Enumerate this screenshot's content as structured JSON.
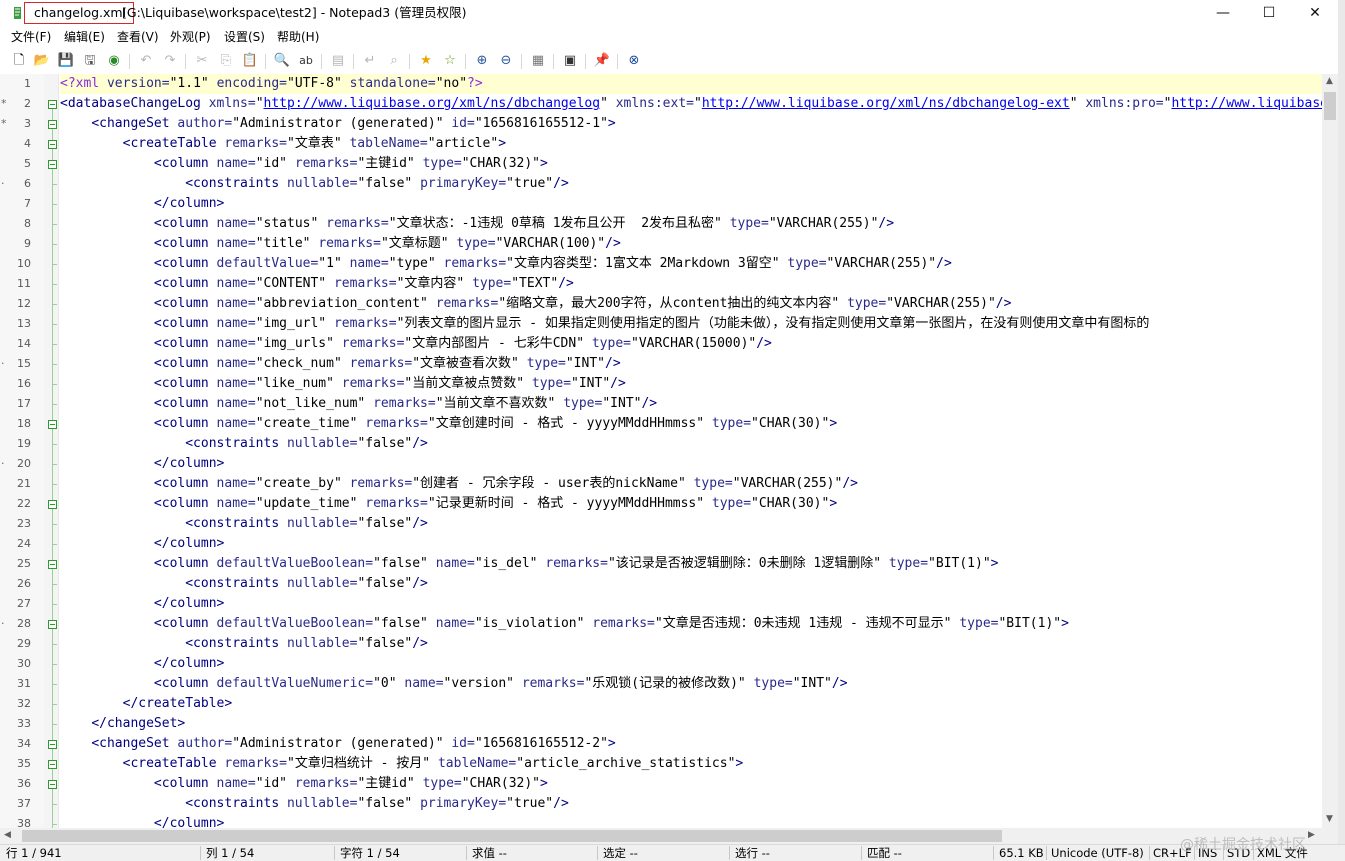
{
  "window": {
    "file_name": "changelog.xml",
    "title_rest": "[G:\\Liquibase\\workspace\\test2] - Notepad3  (管理员权限)",
    "minimize_glyph": "—",
    "maximize_glyph": "☐",
    "close_glyph": "✕"
  },
  "menu": [
    {
      "label": "文件(F)"
    },
    {
      "label": "编辑(E)"
    },
    {
      "label": "查看(V)"
    },
    {
      "label": "外观(P)"
    },
    {
      "label": "设置(S)"
    },
    {
      "label": "帮助(H)"
    }
  ],
  "toolbar": [
    {
      "name": "new-file-icon",
      "glyph": "🗋"
    },
    {
      "name": "open-folder-icon",
      "glyph": "📂"
    },
    {
      "name": "save-icon",
      "glyph": "💾"
    },
    {
      "name": "save-as-icon",
      "glyph": "🖫"
    },
    {
      "name": "browse-icon",
      "glyph": "◉"
    },
    {
      "name": "undo-icon",
      "glyph": "↶"
    },
    {
      "name": "redo-icon",
      "glyph": "↷"
    },
    {
      "name": "cut-icon",
      "glyph": "✂"
    },
    {
      "name": "copy-icon",
      "glyph": "⎘"
    },
    {
      "name": "paste-icon",
      "glyph": "📋"
    },
    {
      "name": "find-icon",
      "glyph": "🔍"
    },
    {
      "name": "replace-icon",
      "glyph": "ab"
    },
    {
      "name": "goto-icon",
      "glyph": "▤"
    },
    {
      "name": "wordwrap-icon",
      "glyph": "↵"
    },
    {
      "name": "find-next-icon",
      "glyph": "⌕"
    },
    {
      "name": "favorite-icon",
      "glyph": "★"
    },
    {
      "name": "add-favorite-icon",
      "glyph": "☆"
    },
    {
      "name": "zoom-in-icon",
      "glyph": "⊕"
    },
    {
      "name": "zoom-out-icon",
      "glyph": "⊖"
    },
    {
      "name": "scheme-icon",
      "glyph": "▦"
    },
    {
      "name": "console-icon",
      "glyph": "▣"
    },
    {
      "name": "pin-icon",
      "glyph": "📌"
    },
    {
      "name": "close-doc-icon",
      "glyph": "⊗"
    }
  ],
  "code_lines": [
    [
      [
        "pi",
        "<?xml "
      ],
      [
        "piattr",
        "version="
      ],
      [
        "val",
        "\"1.1\" "
      ],
      [
        "piattr",
        "encoding="
      ],
      [
        "val",
        "\"UTF-8\" "
      ],
      [
        "piattr",
        "standalone="
      ],
      [
        "val",
        "\"no\""
      ],
      [
        "pi",
        "?>"
      ]
    ],
    [
      [
        "tag",
        "<databaseChangeLog "
      ],
      [
        "attr",
        "xmlns="
      ],
      [
        "val",
        "\""
      ],
      [
        "url",
        "http://www.liquibase.org/xml/ns/dbchangelog"
      ],
      [
        "val",
        "\" "
      ],
      [
        "attr",
        "xmlns:ext="
      ],
      [
        "val",
        "\""
      ],
      [
        "url",
        "http://www.liquibase.org/xml/ns/dbchangelog-ext"
      ],
      [
        "val",
        "\" "
      ],
      [
        "attr",
        "xmlns:pro="
      ],
      [
        "val",
        "\""
      ],
      [
        "url",
        "http://www.liquibase.org/xml/ns/pro"
      ]
    ],
    [
      [
        "val",
        "    "
      ],
      [
        "tag",
        "<changeSet "
      ],
      [
        "attr",
        "author="
      ],
      [
        "val",
        "\"Administrator (generated)\" "
      ],
      [
        "attr",
        "id="
      ],
      [
        "val",
        "\"1656816165512-1\""
      ],
      [
        "tag",
        ">"
      ]
    ],
    [
      [
        "val",
        "        "
      ],
      [
        "tag",
        "<createTable "
      ],
      [
        "attr",
        "remarks="
      ],
      [
        "val",
        "\"文章表\" "
      ],
      [
        "attr",
        "tableName="
      ],
      [
        "val",
        "\"article\""
      ],
      [
        "tag",
        ">"
      ]
    ],
    [
      [
        "val",
        "            "
      ],
      [
        "tag",
        "<column "
      ],
      [
        "attr",
        "name="
      ],
      [
        "val",
        "\"id\" "
      ],
      [
        "attr",
        "remarks="
      ],
      [
        "val",
        "\"主键id\" "
      ],
      [
        "attr",
        "type="
      ],
      [
        "val",
        "\"CHAR(32)\""
      ],
      [
        "tag",
        ">"
      ]
    ],
    [
      [
        "val",
        "                "
      ],
      [
        "tag",
        "<constraints "
      ],
      [
        "attr",
        "nullable="
      ],
      [
        "val",
        "\"false\" "
      ],
      [
        "attr",
        "primaryKey="
      ],
      [
        "val",
        "\"true\""
      ],
      [
        "tag",
        "/>"
      ]
    ],
    [
      [
        "val",
        "            "
      ],
      [
        "tag",
        "</column>"
      ]
    ],
    [
      [
        "val",
        "            "
      ],
      [
        "tag",
        "<column "
      ],
      [
        "attr",
        "name="
      ],
      [
        "val",
        "\"status\" "
      ],
      [
        "attr",
        "remarks="
      ],
      [
        "val",
        "\"文章状态：-1违规 0草稿 1发布且公开  2发布且私密\" "
      ],
      [
        "attr",
        "type="
      ],
      [
        "val",
        "\"VARCHAR(255)\""
      ],
      [
        "tag",
        "/>"
      ]
    ],
    [
      [
        "val",
        "            "
      ],
      [
        "tag",
        "<column "
      ],
      [
        "attr",
        "name="
      ],
      [
        "val",
        "\"title\" "
      ],
      [
        "attr",
        "remarks="
      ],
      [
        "val",
        "\"文章标题\" "
      ],
      [
        "attr",
        "type="
      ],
      [
        "val",
        "\"VARCHAR(100)\""
      ],
      [
        "tag",
        "/>"
      ]
    ],
    [
      [
        "val",
        "            "
      ],
      [
        "tag",
        "<column "
      ],
      [
        "attr",
        "defaultValue="
      ],
      [
        "val",
        "\"1\" "
      ],
      [
        "attr",
        "name="
      ],
      [
        "val",
        "\"type\" "
      ],
      [
        "attr",
        "remarks="
      ],
      [
        "val",
        "\"文章内容类型：1富文本 2Markdown 3留空\" "
      ],
      [
        "attr",
        "type="
      ],
      [
        "val",
        "\"VARCHAR(255)\""
      ],
      [
        "tag",
        "/>"
      ]
    ],
    [
      [
        "val",
        "            "
      ],
      [
        "tag",
        "<column "
      ],
      [
        "attr",
        "name="
      ],
      [
        "val",
        "\"CONTENT\" "
      ],
      [
        "attr",
        "remarks="
      ],
      [
        "val",
        "\"文章内容\" "
      ],
      [
        "attr",
        "type="
      ],
      [
        "val",
        "\"TEXT\""
      ],
      [
        "tag",
        "/>"
      ]
    ],
    [
      [
        "val",
        "            "
      ],
      [
        "tag",
        "<column "
      ],
      [
        "attr",
        "name="
      ],
      [
        "val",
        "\"abbreviation_content\" "
      ],
      [
        "attr",
        "remarks="
      ],
      [
        "val",
        "\"缩略文章，最大200字符，从content抽出的纯文本内容\" "
      ],
      [
        "attr",
        "type="
      ],
      [
        "val",
        "\"VARCHAR(255)\""
      ],
      [
        "tag",
        "/>"
      ]
    ],
    [
      [
        "val",
        "            "
      ],
      [
        "tag",
        "<column "
      ],
      [
        "attr",
        "name="
      ],
      [
        "val",
        "\"img_url\" "
      ],
      [
        "attr",
        "remarks="
      ],
      [
        "val",
        "\"列表文章的图片显示 - 如果指定则使用指定的图片（功能未做），没有指定则使用文章第一张图片，在没有则使用文章中有图标的"
      ]
    ],
    [
      [
        "val",
        "            "
      ],
      [
        "tag",
        "<column "
      ],
      [
        "attr",
        "name="
      ],
      [
        "val",
        "\"img_urls\" "
      ],
      [
        "attr",
        "remarks="
      ],
      [
        "val",
        "\"文章内部图片 - 七彩牛CDN\" "
      ],
      [
        "attr",
        "type="
      ],
      [
        "val",
        "\"VARCHAR(15000)\""
      ],
      [
        "tag",
        "/>"
      ]
    ],
    [
      [
        "val",
        "            "
      ],
      [
        "tag",
        "<column "
      ],
      [
        "attr",
        "name="
      ],
      [
        "val",
        "\"check_num\" "
      ],
      [
        "attr",
        "remarks="
      ],
      [
        "val",
        "\"文章被查看次数\" "
      ],
      [
        "attr",
        "type="
      ],
      [
        "val",
        "\"INT\""
      ],
      [
        "tag",
        "/>"
      ]
    ],
    [
      [
        "val",
        "            "
      ],
      [
        "tag",
        "<column "
      ],
      [
        "attr",
        "name="
      ],
      [
        "val",
        "\"like_num\" "
      ],
      [
        "attr",
        "remarks="
      ],
      [
        "val",
        "\"当前文章被点赞数\" "
      ],
      [
        "attr",
        "type="
      ],
      [
        "val",
        "\"INT\""
      ],
      [
        "tag",
        "/>"
      ]
    ],
    [
      [
        "val",
        "            "
      ],
      [
        "tag",
        "<column "
      ],
      [
        "attr",
        "name="
      ],
      [
        "val",
        "\"not_like_num\" "
      ],
      [
        "attr",
        "remarks="
      ],
      [
        "val",
        "\"当前文章不喜欢数\" "
      ],
      [
        "attr",
        "type="
      ],
      [
        "val",
        "\"INT\""
      ],
      [
        "tag",
        "/>"
      ]
    ],
    [
      [
        "val",
        "            "
      ],
      [
        "tag",
        "<column "
      ],
      [
        "attr",
        "name="
      ],
      [
        "val",
        "\"create_time\" "
      ],
      [
        "attr",
        "remarks="
      ],
      [
        "val",
        "\"文章创建时间 - 格式 - yyyyMMddHHmmss\" "
      ],
      [
        "attr",
        "type="
      ],
      [
        "val",
        "\"CHAR(30)\""
      ],
      [
        "tag",
        ">"
      ]
    ],
    [
      [
        "val",
        "                "
      ],
      [
        "tag",
        "<constraints "
      ],
      [
        "attr",
        "nullable="
      ],
      [
        "val",
        "\"false\""
      ],
      [
        "tag",
        "/>"
      ]
    ],
    [
      [
        "val",
        "            "
      ],
      [
        "tag",
        "</column>"
      ]
    ],
    [
      [
        "val",
        "            "
      ],
      [
        "tag",
        "<column "
      ],
      [
        "attr",
        "name="
      ],
      [
        "val",
        "\"create_by\" "
      ],
      [
        "attr",
        "remarks="
      ],
      [
        "val",
        "\"创建者 - 冗余字段 - user表的nickName\" "
      ],
      [
        "attr",
        "type="
      ],
      [
        "val",
        "\"VARCHAR(255)\""
      ],
      [
        "tag",
        "/>"
      ]
    ],
    [
      [
        "val",
        "            "
      ],
      [
        "tag",
        "<column "
      ],
      [
        "attr",
        "name="
      ],
      [
        "val",
        "\"update_time\" "
      ],
      [
        "attr",
        "remarks="
      ],
      [
        "val",
        "\"记录更新时间 - 格式 - yyyyMMddHHmmss\" "
      ],
      [
        "attr",
        "type="
      ],
      [
        "val",
        "\"CHAR(30)\""
      ],
      [
        "tag",
        ">"
      ]
    ],
    [
      [
        "val",
        "                "
      ],
      [
        "tag",
        "<constraints "
      ],
      [
        "attr",
        "nullable="
      ],
      [
        "val",
        "\"false\""
      ],
      [
        "tag",
        "/>"
      ]
    ],
    [
      [
        "val",
        "            "
      ],
      [
        "tag",
        "</column>"
      ]
    ],
    [
      [
        "val",
        "            "
      ],
      [
        "tag",
        "<column "
      ],
      [
        "attr",
        "defaultValueBoolean="
      ],
      [
        "val",
        "\"false\" "
      ],
      [
        "attr",
        "name="
      ],
      [
        "val",
        "\"is_del\" "
      ],
      [
        "attr",
        "remarks="
      ],
      [
        "val",
        "\"该记录是否被逻辑删除：0未删除 1逻辑删除\" "
      ],
      [
        "attr",
        "type="
      ],
      [
        "val",
        "\"BIT(1)\""
      ],
      [
        "tag",
        ">"
      ]
    ],
    [
      [
        "val",
        "                "
      ],
      [
        "tag",
        "<constraints "
      ],
      [
        "attr",
        "nullable="
      ],
      [
        "val",
        "\"false\""
      ],
      [
        "tag",
        "/>"
      ]
    ],
    [
      [
        "val",
        "            "
      ],
      [
        "tag",
        "</column>"
      ]
    ],
    [
      [
        "val",
        "            "
      ],
      [
        "tag",
        "<column "
      ],
      [
        "attr",
        "defaultValueBoolean="
      ],
      [
        "val",
        "\"false\" "
      ],
      [
        "attr",
        "name="
      ],
      [
        "val",
        "\"is_violation\" "
      ],
      [
        "attr",
        "remarks="
      ],
      [
        "val",
        "\"文章是否违规：0未违规 1违规 - 违规不可显示\" "
      ],
      [
        "attr",
        "type="
      ],
      [
        "val",
        "\"BIT(1)\""
      ],
      [
        "tag",
        ">"
      ]
    ],
    [
      [
        "val",
        "                "
      ],
      [
        "tag",
        "<constraints "
      ],
      [
        "attr",
        "nullable="
      ],
      [
        "val",
        "\"false\""
      ],
      [
        "tag",
        "/>"
      ]
    ],
    [
      [
        "val",
        "            "
      ],
      [
        "tag",
        "</column>"
      ]
    ],
    [
      [
        "val",
        "            "
      ],
      [
        "tag",
        "<column "
      ],
      [
        "attr",
        "defaultValueNumeric="
      ],
      [
        "val",
        "\"0\" "
      ],
      [
        "attr",
        "name="
      ],
      [
        "val",
        "\"version\" "
      ],
      [
        "attr",
        "remarks="
      ],
      [
        "val",
        "\"乐观锁(记录的被修改数)\" "
      ],
      [
        "attr",
        "type="
      ],
      [
        "val",
        "\"INT\""
      ],
      [
        "tag",
        "/>"
      ]
    ],
    [
      [
        "val",
        "        "
      ],
      [
        "tag",
        "</createTable>"
      ]
    ],
    [
      [
        "val",
        "    "
      ],
      [
        "tag",
        "</changeSet>"
      ]
    ],
    [
      [
        "val",
        "    "
      ],
      [
        "tag",
        "<changeSet "
      ],
      [
        "attr",
        "author="
      ],
      [
        "val",
        "\"Administrator (generated)\" "
      ],
      [
        "attr",
        "id="
      ],
      [
        "val",
        "\"1656816165512-2\""
      ],
      [
        "tag",
        ">"
      ]
    ],
    [
      [
        "val",
        "        "
      ],
      [
        "tag",
        "<createTable "
      ],
      [
        "attr",
        "remarks="
      ],
      [
        "val",
        "\"文章归档统计 - 按月\" "
      ],
      [
        "attr",
        "tableName="
      ],
      [
        "val",
        "\"article_archive_statistics\""
      ],
      [
        "tag",
        ">"
      ]
    ],
    [
      [
        "val",
        "            "
      ],
      [
        "tag",
        "<column "
      ],
      [
        "attr",
        "name="
      ],
      [
        "val",
        "\"id\" "
      ],
      [
        "attr",
        "remarks="
      ],
      [
        "val",
        "\"主键id\" "
      ],
      [
        "attr",
        "type="
      ],
      [
        "val",
        "\"CHAR(32)\""
      ],
      [
        "tag",
        ">"
      ]
    ],
    [
      [
        "val",
        "                "
      ],
      [
        "tag",
        "<constraints "
      ],
      [
        "attr",
        "nullable="
      ],
      [
        "val",
        "\"false\" "
      ],
      [
        "attr",
        "primaryKey="
      ],
      [
        "val",
        "\"true\""
      ],
      [
        "tag",
        "/>"
      ]
    ],
    [
      [
        "val",
        "            "
      ],
      [
        "tag",
        "</column>"
      ]
    ]
  ],
  "fold_lines": [
    2,
    3,
    4,
    5,
    18,
    22,
    25,
    28,
    34,
    35,
    36
  ],
  "gutter_marks": {
    "2": "*",
    "3": "*",
    "6": "·",
    "15": "·",
    "20": "·",
    "28": "·"
  },
  "status": {
    "line": "行  1 / 941",
    "col": "列  1 / 54",
    "char": "字符  1 / 54",
    "value": "求值  --",
    "selected": "选定  --",
    "sel_lines": "选行  --",
    "match": "匹配  --",
    "size": "65.1 KB",
    "encoding": "Unicode (UTF-8)",
    "eol": "CR+LF",
    "ins": "INS",
    "std": "STD",
    "lexer": "XML 文件"
  },
  "watermark": "@稀土掘金技术社区"
}
